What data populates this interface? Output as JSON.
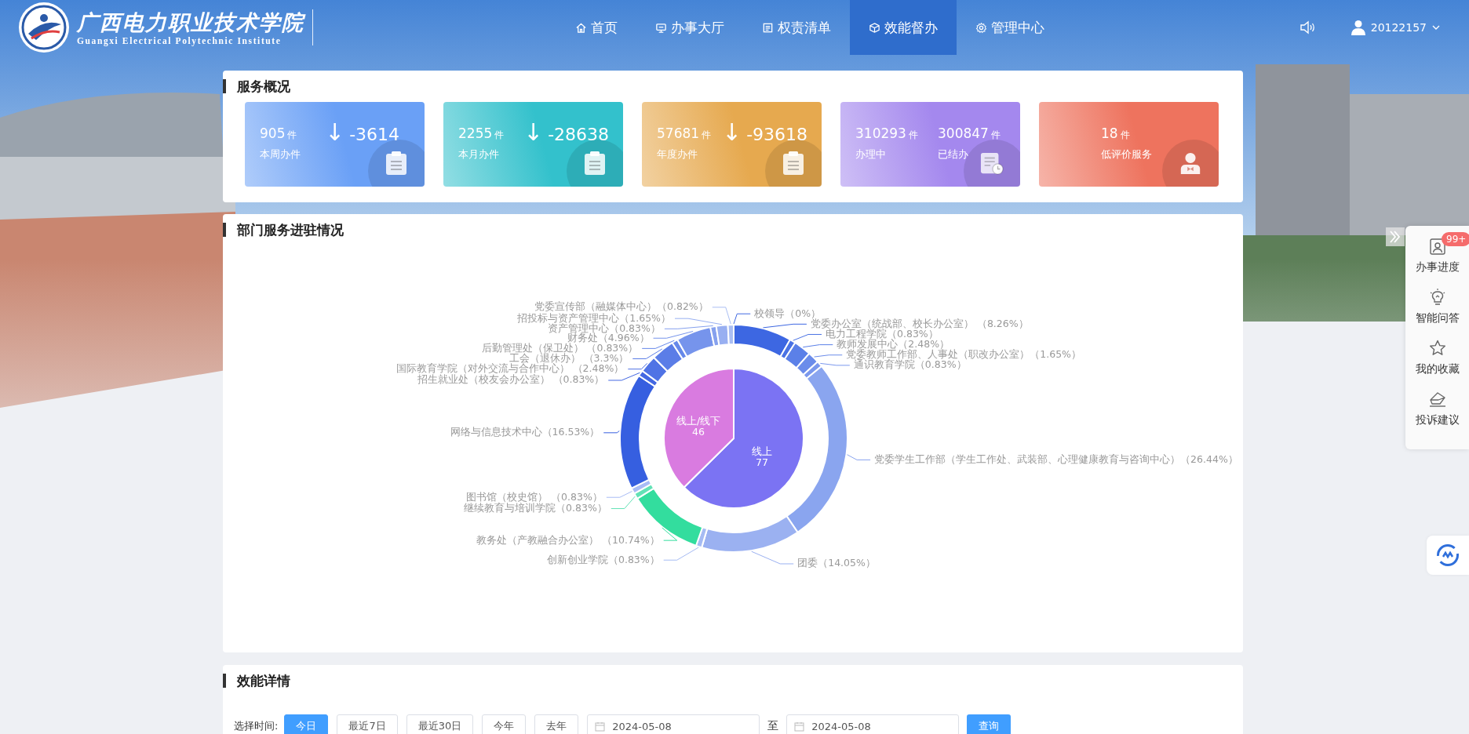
{
  "header": {
    "school_name": "广西电力职业技术学院",
    "school_name_en": "Guangxi Electrical Polytechnic Institute",
    "nav": [
      {
        "label": "首页",
        "selected": false
      },
      {
        "label": "办事大厅",
        "selected": false
      },
      {
        "label": "权责清单",
        "selected": false
      },
      {
        "label": "效能督办",
        "selected": true
      },
      {
        "label": "管理中心",
        "selected": false
      }
    ],
    "user": "20122157"
  },
  "overview": {
    "title": "服务概况",
    "cards": [
      {
        "kind": "trend",
        "color": "#6aa0f6",
        "stats": [
          {
            "value": "905",
            "unit": "件",
            "label": "本周办件"
          }
        ],
        "arrow": "↓",
        "change": "-3614"
      },
      {
        "kind": "trend",
        "color": "#33c1cc",
        "stats": [
          {
            "value": "2255",
            "unit": "件",
            "label": "本月办件"
          }
        ],
        "arrow": "↓",
        "change": "-28638"
      },
      {
        "kind": "trend",
        "color": "#e6a94f",
        "stats": [
          {
            "value": "57681",
            "unit": "件",
            "label": "年度办件"
          }
        ],
        "arrow": "↓",
        "change": "-93618"
      },
      {
        "kind": "double",
        "color": "#a488ee",
        "stats": [
          {
            "value": "310293",
            "unit": "件",
            "label": "办理中"
          },
          {
            "value": "300847",
            "unit": "件",
            "label": "已结办"
          }
        ]
      },
      {
        "kind": "single",
        "color": "#ee735e",
        "stats": [
          {
            "value": "18",
            "unit": "件",
            "label": "低评价服务"
          }
        ]
      }
    ]
  },
  "departments": {
    "title": "部门服务进驻情况",
    "ring_chart": {
      "chart_data": {
        "type": "donut",
        "categories": [
          "校领导（0%）",
          "党委办公室（统战部、校长办公室） （8.26%）",
          "电力工程学院（0.83%）",
          "教师发展中心（2.48%）",
          "党委教师工作部、人事处（职改办公室）（1.65%）",
          "通识教育学院（0.83%）",
          "党委学生工作部（学生工作处、武装部、心理健康教育与咨询中心）（26.44%）",
          "团委（14.05%）",
          "创新创业学院（0.83%）",
          "教务处（产教融合办公室） （10.74%）",
          "继续教育与培训学院（0.83%）",
          "图书馆（校史馆） （0.83%）",
          "网络与信息技术中心（16.53%）",
          "招生就业处（校友会办公室） （0.83%）",
          "国际教育学院（对外交流与合作中心） （2.48%）",
          "工会（退休办） （3.3%）",
          "后勤管理处（保卫处） （0.83%）",
          "财务处（4.96%）",
          "资产管理中心（0.83%）",
          "招投标与资产管理中心（1.65%）",
          "党委宣传部（融媒体中心）（0.82%）"
        ],
        "series": [
          {
            "values": [
              0,
              8.26,
              0.83,
              2.48,
              1.65,
              0.83,
              26.44,
              14.05,
              0.83,
              10.74,
              0.83,
              0.83,
              16.53,
              0.83,
              2.48,
              3.3,
              0.83,
              4.96,
              0.83,
              1.65,
              0.82
            ]
          }
        ]
      }
    },
    "center_chart": {
      "chart_data": {
        "type": "pie",
        "data_labels": true,
        "categories": [
          "线上",
          "线上/线下"
        ],
        "series": [
          {
            "values": [
              77,
              46
            ]
          }
        ]
      }
    }
  },
  "details": {
    "title": "效能详情",
    "time_label": "选择时间:",
    "ranges": [
      {
        "label": "今日",
        "selected": true
      },
      {
        "label": "最近7日",
        "selected": false
      },
      {
        "label": "最近30日",
        "selected": false
      },
      {
        "label": "今年",
        "selected": false
      },
      {
        "label": "去年",
        "selected": false
      }
    ],
    "start_date": "2024-05-08",
    "separator": "至",
    "end_date": "2024-05-08",
    "query_button": "查询"
  },
  "side_panel": {
    "items": [
      {
        "label": "办事进度",
        "badge": "99+"
      },
      {
        "label": "智能问答"
      },
      {
        "label": "我的收藏"
      },
      {
        "label": "投诉建议"
      }
    ]
  }
}
